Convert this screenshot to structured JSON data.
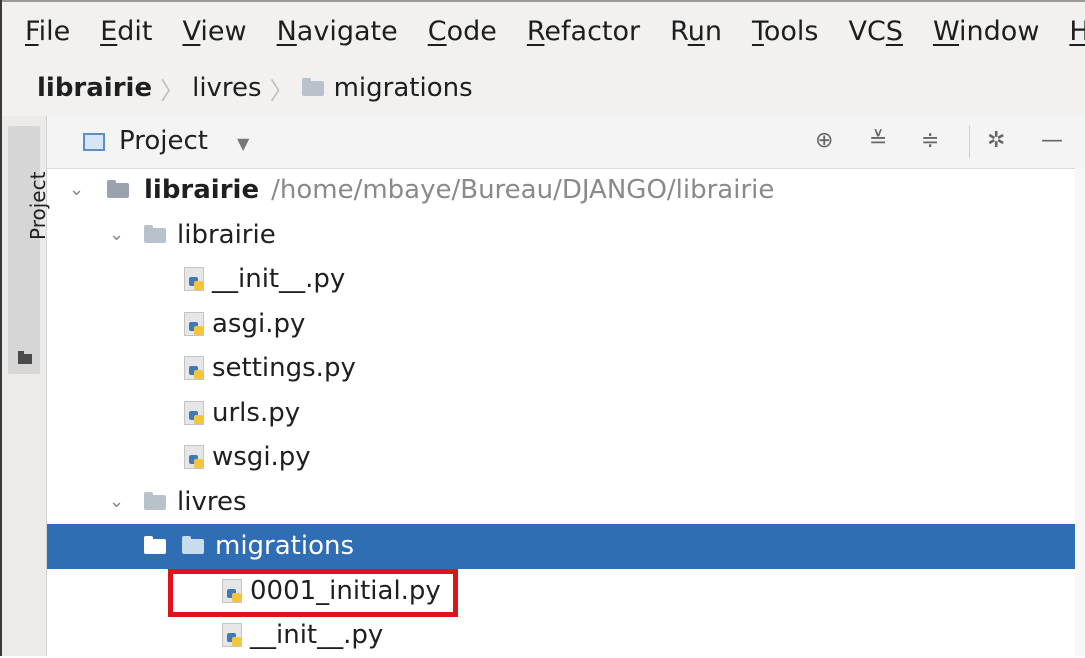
{
  "menu": {
    "items": [
      {
        "label": "File"
      },
      {
        "label": "Edit"
      },
      {
        "label": "View"
      },
      {
        "label": "Navigate"
      },
      {
        "label": "Code"
      },
      {
        "label": "Refactor"
      },
      {
        "label": "Run"
      },
      {
        "label": "Tools"
      },
      {
        "label": "VCS"
      },
      {
        "label": "Window"
      },
      {
        "label": "Help"
      }
    ]
  },
  "breadcrumb": {
    "root": "librairie",
    "item1": "livres",
    "item2": "migrations"
  },
  "tool_window": {
    "tab_label": "Project"
  },
  "panel": {
    "view_label": "Project",
    "icons": [
      "locate-icon",
      "expand-all-icon",
      "collapse-all-icon",
      "gear-icon",
      "minimize-icon"
    ]
  },
  "tree": {
    "root_label": "librairie",
    "root_path": "/home/mbaye/Bureau/DJANGO/librairie",
    "rows": [
      {
        "label": "librairie"
      },
      {
        "label": "__init__.py"
      },
      {
        "label": "asgi.py"
      },
      {
        "label": "settings.py"
      },
      {
        "label": "urls.py"
      },
      {
        "label": "wsgi.py"
      },
      {
        "label": "livres"
      },
      {
        "label": "migrations"
      },
      {
        "label": "0001_initial.py"
      },
      {
        "label": "__init__.py"
      }
    ]
  },
  "colors": {
    "selection": "#2f6db5",
    "highlight": "#e0131b"
  }
}
